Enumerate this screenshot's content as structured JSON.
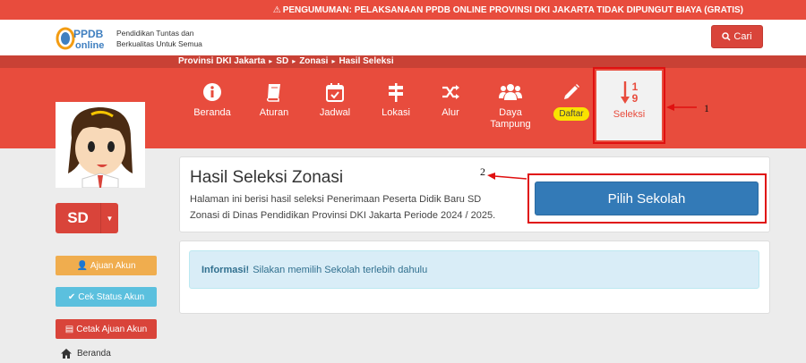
{
  "announcement": "PENGUMUMAN: PELAKSANAAN PPDB ONLINE PROVINSI DKI JAKARTA TIDAK DIPUNGUT BIAYA (GRATIS)",
  "header": {
    "logo_text_top": "PPDB",
    "logo_text_bottom": "online",
    "tagline_line1": "Pendidikan Tuntas dan",
    "tagline_line2": "Berkualitas Untuk Semua",
    "search_label": "Cari"
  },
  "breadcrumb": [
    "Provinsi DKI Jakarta",
    "SD",
    "Zonasi",
    "Hasil Seleksi"
  ],
  "nav": {
    "beranda": "Beranda",
    "aturan": "Aturan",
    "jadwal": "Jadwal",
    "lokasi": "Lokasi",
    "alur": "Alur",
    "daya_line1": "Daya",
    "daya_line2": "Tampung",
    "daftar": "Daftar",
    "seleksi": "Seleksi",
    "seleksi_num_top": "1",
    "seleksi_num_bottom": "9"
  },
  "sidebar": {
    "level": "SD",
    "ajuan_akun": "Ajuan Akun",
    "cek_status": "Cek Status Akun",
    "cetak_ajuan": "Cetak Ajuan Akun",
    "beranda": "Beranda"
  },
  "main": {
    "title": "Hasil Seleksi Zonasi",
    "description": "Halaman ini berisi hasil seleksi Penerimaan Peserta Didik Baru SD Zonasi di Dinas Pendidikan Provinsi DKI Jakarta Periode 2024 / 2025.",
    "pilih_button": "Pilih Sekolah",
    "info_bold": "Informasi!",
    "info_text": "Silakan memilih Sekolah terlebih dahulu"
  },
  "annotations": {
    "label1": "1",
    "label2": "2"
  },
  "colors": {
    "accent_red": "#e84c3d",
    "primary_blue": "#337ab7",
    "warning": "#f0ad4e",
    "info": "#5bc0de",
    "danger": "#d9443a"
  }
}
